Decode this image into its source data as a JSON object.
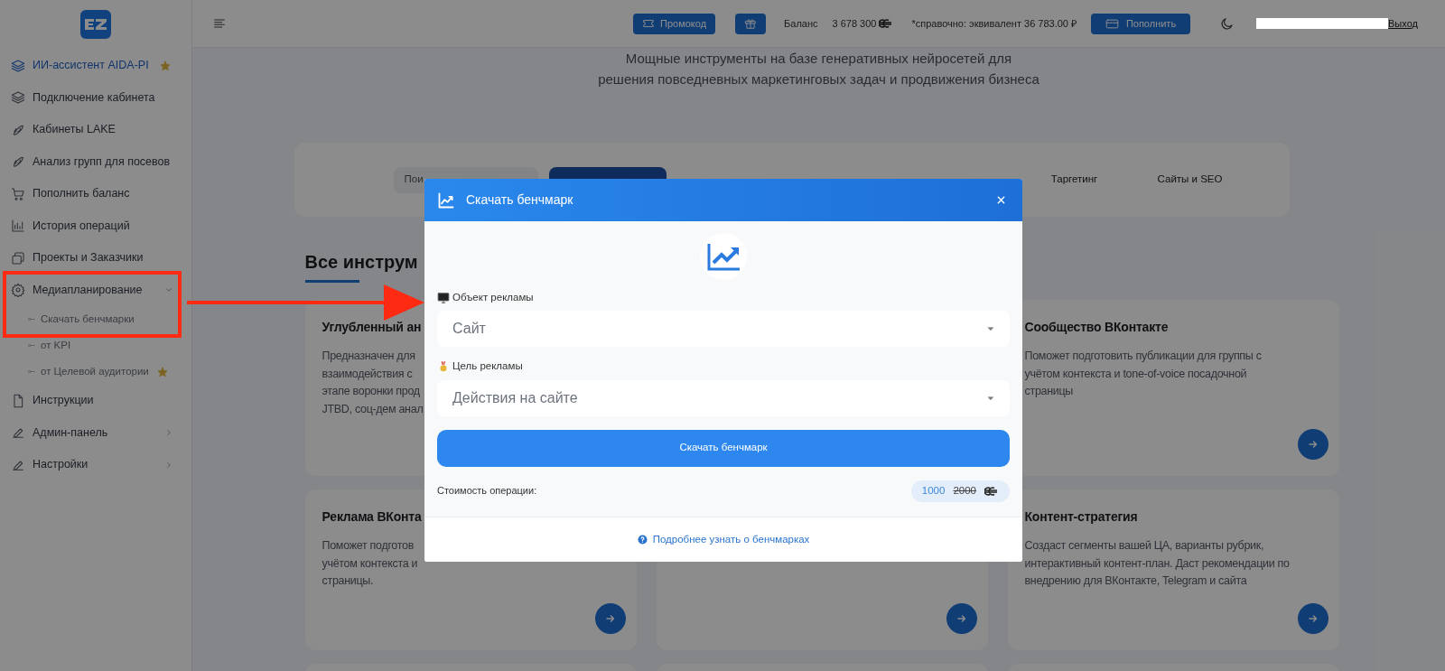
{
  "header": {
    "promo_button": "Промокод",
    "balance_label": "Баланс",
    "balance": "3 678 300",
    "equivalent": "*справочно: эквивалент 36 783.00 ₽",
    "topup_button": "Пополнить",
    "logout_link": "Выход"
  },
  "sidebar": {
    "items": [
      {
        "label": "ИИ-ассистент AIDA-PI",
        "selected": true,
        "starred": true
      },
      {
        "label": "Подключение кабинета",
        "selected": false,
        "starred": false
      },
      {
        "label": "Кабинеты LAKE",
        "selected": false,
        "starred": false
      },
      {
        "label": "Анализ групп для посевов",
        "selected": false,
        "starred": false
      },
      {
        "label": "Пополнить баланс",
        "selected": false,
        "starred": false
      },
      {
        "label": "История операций",
        "selected": false,
        "starred": false
      },
      {
        "label": "Проекты и Заказчики",
        "selected": false,
        "starred": false
      },
      {
        "label": "Медиапланирование",
        "selected": false,
        "starred": false,
        "expanded": true,
        "children": [
          {
            "label": "Скачать бенчмарки",
            "selected": false,
            "starred": false
          },
          {
            "label": "от KPI",
            "selected": false,
            "starred": false
          },
          {
            "label": "от Целевой аудитории",
            "selected": false,
            "starred": true
          }
        ]
      },
      {
        "label": "Инструкции",
        "selected": false,
        "starred": false
      },
      {
        "label": "Админ-панель",
        "selected": false,
        "starred": false,
        "expanded": false
      },
      {
        "label": "Настройки",
        "selected": false,
        "starred": false,
        "expanded": false
      }
    ]
  },
  "hero_text": "Мощные инструменты на базе генеративных нейросетей для\nрешения повседневных маркетинговых задач и продвижения бизнеса",
  "tabs": [
    {
      "label": "Пои",
      "selected": false
    },
    {
      "selected": true
    },
    {
      "label": "Таргетинг",
      "selected": false
    },
    {
      "label": "Сайты и SEO",
      "selected": false
    }
  ],
  "section_heading": "Все инструм",
  "cards": [
    {
      "title": "Углубленный ан",
      "description": "Предназначен для\nвзаимодействия с\nэтапе воронки прод\nJTBD, соц-дем анал",
      "arrow": false
    },
    {
      "title": "Сообщество ВКонтакте",
      "description": "Поможет подготовить публикации для группы с\nучётом контекста и tone-of-voice посадочной\nстраницы",
      "arrow": true
    },
    {
      "title": "Реклама ВКонта",
      "description": "Поможет подготов\nучётом контекста и\nстраницы.",
      "arrow": true
    },
    {
      "arrow": true
    },
    {
      "title": "Контент-стратегия",
      "description": "Создаст сегменты вашей ЦА, варианты рубрик,\nинтерактивный контент-план. Даст рекомендации по\nвнедрению для ВКонтакте, Telegram и сайта",
      "arrow": true
    },
    {
      "arrow": false
    },
    {
      "arrow": false
    },
    {
      "arrow": false
    }
  ],
  "modal": {
    "title": "Скачать бенчмарк",
    "fields": [
      {
        "label": "Объект рекламы",
        "value": "Сайт"
      },
      {
        "label": "Цель рекламы",
        "value": "Действия на сайте"
      }
    ],
    "submit_button": "Скачать бенчмарк",
    "cost_label": "Стоимость операции:",
    "price": "1000",
    "old_price": "2000",
    "help_link": "Подробнее узнать о бенчмарках"
  }
}
